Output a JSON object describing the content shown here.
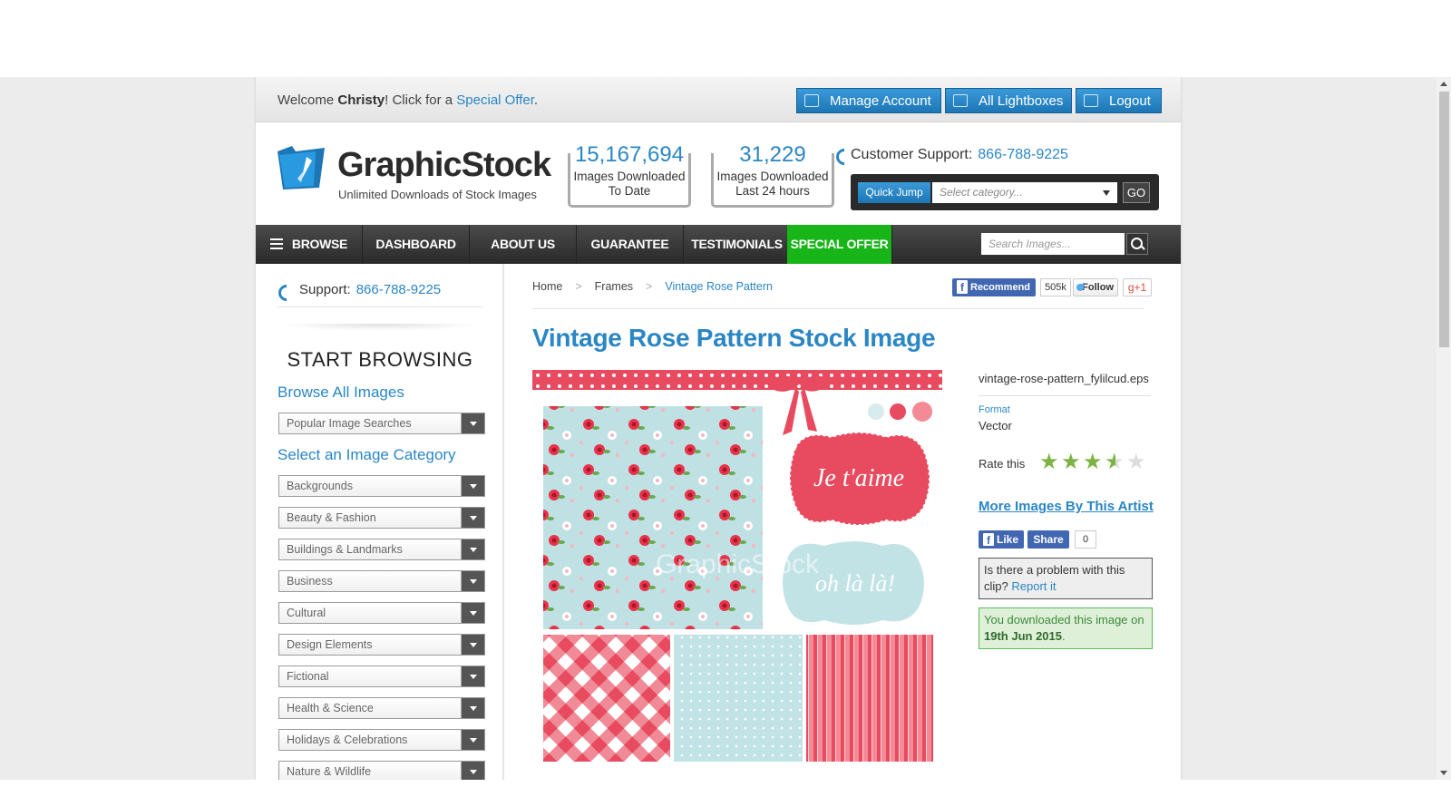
{
  "topbar": {
    "welcome_prefix": "Welcome ",
    "user_name": "Christy",
    "welcome_mid": "! Click for a ",
    "special_offer_link": "Special Offer",
    "welcome_suffix": ".",
    "buttons": [
      "Manage Account",
      "All Lightboxes",
      "Logout"
    ]
  },
  "logo": {
    "name": "GraphicStock",
    "tagline": "Unlimited Downloads of Stock Images"
  },
  "stats": [
    {
      "number": "15,167,694",
      "label_line1": "Images Downloaded",
      "label_line2": "To Date"
    },
    {
      "number": "31,229",
      "label_line1": "Images Downloaded",
      "label_line2": "Last 24 hours"
    }
  ],
  "support": {
    "label": "Customer Support:",
    "phone": "866-788-9225"
  },
  "quick_jump": {
    "button": "Quick Jump",
    "placeholder": "Select category...",
    "go": "GO"
  },
  "nav": {
    "items": [
      "BROWSE",
      "DASHBOARD",
      "ABOUT US",
      "GUARANTEE",
      "TESTIMONIALS",
      "SPECIAL OFFER"
    ],
    "search_placeholder": "Search Images..."
  },
  "sidebar": {
    "support_label": "Support:",
    "support_phone": "866-788-9225",
    "start_browsing": "START BROWSING",
    "browse_all": "Browse All Images",
    "popular_searches": "Popular Image Searches",
    "select_category": "Select an Image Category",
    "categories": [
      "Backgrounds",
      "Beauty & Fashion",
      "Buildings & Landmarks",
      "Business",
      "Cultural",
      "Design Elements",
      "Fictional",
      "Health & Science",
      "Holidays & Celebrations",
      "Nature & Wildlife"
    ]
  },
  "breadcrumb": [
    "Home",
    "Frames",
    "Vintage Rose Pattern"
  ],
  "social_top": {
    "recommend": "Recommend",
    "recommend_count": "505k",
    "follow": "Follow",
    "gplus": "g+1"
  },
  "image": {
    "title": "Vintage Rose Pattern Stock Image",
    "label_text_1": "Je t'aime",
    "label_text_2": "oh là là!",
    "watermark": "GraphicStock",
    "filename": "vintage-rose-pattern_fylilcud.eps",
    "format_label": "Format",
    "format_value": "Vector",
    "rate_label": "Rate this",
    "rating": 3.5,
    "rating_max": 5,
    "more_by_artist": "More Images By This Artist"
  },
  "social_bottom": {
    "like": "Like",
    "share": "Share",
    "share_count": "0"
  },
  "problem": {
    "text": "Is there a problem with this clip?",
    "link": "Report it"
  },
  "downloaded": {
    "prefix": "You downloaded this image on",
    "date": "19th Jun 2015",
    "suffix": "."
  },
  "colors": {
    "accent_blue": "#2a86c4",
    "nav_dark": "#333333",
    "special_offer_green": "#17b517",
    "rating_green": "#7cb342",
    "pattern_red": "#e84a5f",
    "pattern_blue": "#bfe1e4"
  }
}
